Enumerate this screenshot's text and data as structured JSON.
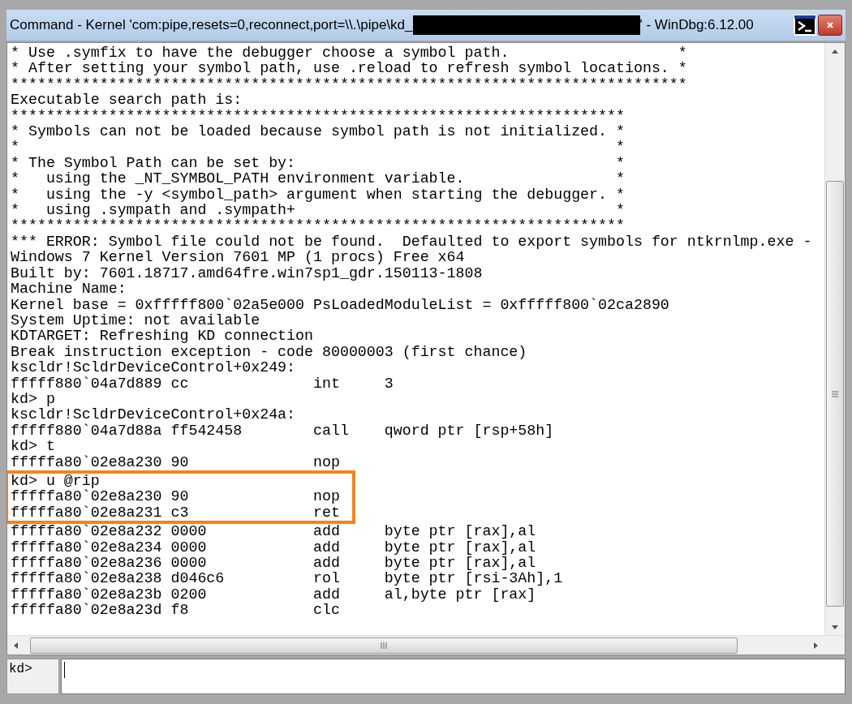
{
  "window": {
    "title_start": "Command - Kernel 'com:pipe,resets=0,reconnect,port=\\\\.\\pipe\\kd_",
    "title_end": "' - WinDbg:6.12.00"
  },
  "output": {
    "lines": [
      {
        "text": "* Use .symfix to have the debugger choose a symbol path.                   *",
        "highlighted": false
      },
      {
        "text": "* After setting your symbol path, use .reload to refresh symbol locations. *",
        "highlighted": false
      },
      {
        "text": "****************************************************************************",
        "highlighted": false
      },
      {
        "text": "Executable search path is:",
        "highlighted": false
      },
      {
        "text": "*********************************************************************",
        "highlighted": false
      },
      {
        "text": "* Symbols can not be loaded because symbol path is not initialized. *",
        "highlighted": false
      },
      {
        "text": "*                                                                   *",
        "highlighted": false
      },
      {
        "text": "* The Symbol Path can be set by:                                    *",
        "highlighted": false
      },
      {
        "text": "*   using the _NT_SYMBOL_PATH environment variable.                 *",
        "highlighted": false
      },
      {
        "text": "*   using the -y <symbol_path> argument when starting the debugger. *",
        "highlighted": false
      },
      {
        "text": "*   using .sympath and .sympath+                                    *",
        "highlighted": false
      },
      {
        "text": "*********************************************************************",
        "highlighted": false
      },
      {
        "text": "*** ERROR: Symbol file could not be found.  Defaulted to export symbols for ntkrnlmp.exe -",
        "highlighted": false
      },
      {
        "text": "Windows 7 Kernel Version 7601 MP (1 procs) Free x64",
        "highlighted": false
      },
      {
        "text": "Built by: 7601.18717.amd64fre.win7sp1_gdr.150113-1808",
        "highlighted": false
      },
      {
        "text": "Machine Name:",
        "highlighted": false
      },
      {
        "text": "Kernel base = 0xfffff800`02a5e000 PsLoadedModuleList = 0xfffff800`02ca2890",
        "highlighted": false
      },
      {
        "text": "System Uptime: not available",
        "highlighted": false
      },
      {
        "text": "KDTARGET: Refreshing KD connection",
        "highlighted": false
      },
      {
        "text": "Break instruction exception - code 80000003 (first chance)",
        "highlighted": false
      },
      {
        "text": "kscldr!ScldrDeviceControl+0x249:",
        "highlighted": false
      },
      {
        "text": "fffff880`04a7d889 cc              int     3",
        "highlighted": false
      },
      {
        "text": "kd> p",
        "highlighted": false
      },
      {
        "text": "kscldr!ScldrDeviceControl+0x24a:",
        "highlighted": false
      },
      {
        "text": "fffff880`04a7d88a ff542458        call    qword ptr [rsp+58h]",
        "highlighted": false
      },
      {
        "text": "kd> t",
        "highlighted": false
      },
      {
        "text": "fffffa80`02e8a230 90              nop",
        "highlighted": false
      },
      {
        "text": "kd> u @rip",
        "highlighted": true
      },
      {
        "text": "fffffa80`02e8a230 90              nop",
        "highlighted": true
      },
      {
        "text": "fffffa80`02e8a231 c3              ret",
        "highlighted": true
      },
      {
        "text": "fffffa80`02e8a232 0000            add     byte ptr [rax],al",
        "highlighted": false
      },
      {
        "text": "fffffa80`02e8a234 0000            add     byte ptr [rax],al",
        "highlighted": false
      },
      {
        "text": "fffffa80`02e8a236 0000            add     byte ptr [rax],al",
        "highlighted": false
      },
      {
        "text": "fffffa80`02e8a238 d046c6          rol     byte ptr [rsi-3Ah],1",
        "highlighted": false
      },
      {
        "text": "fffffa80`02e8a23b 0200            add     al,byte ptr [rax]",
        "highlighted": false
      },
      {
        "text": "fffffa80`02e8a23d f8              clc",
        "highlighted": false
      }
    ]
  },
  "command_bar": {
    "prompt": "kd>"
  }
}
